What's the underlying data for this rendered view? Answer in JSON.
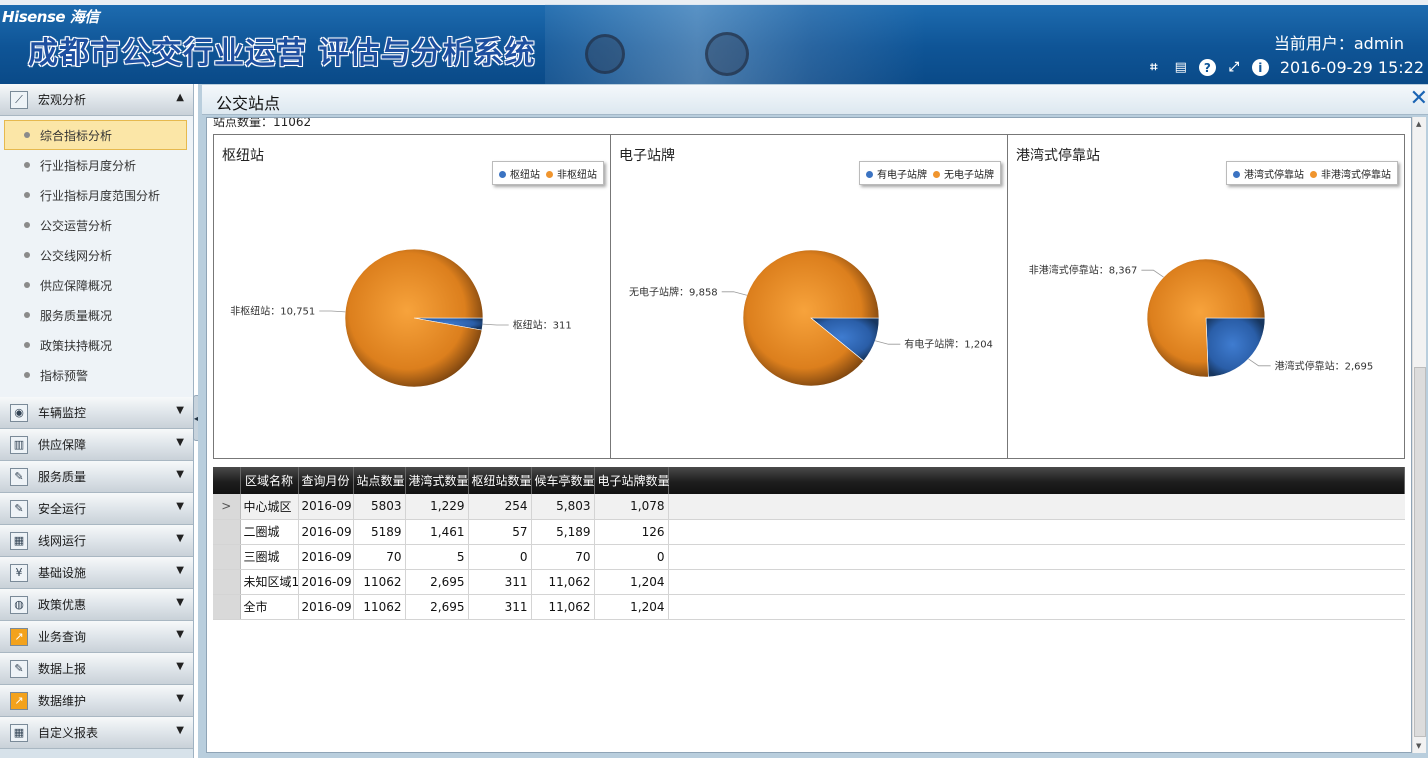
{
  "header": {
    "brand": "Hisense 海信",
    "title": "成都市公交行业运营 评估与分析系统",
    "user_line": "当前用户：admin",
    "datetime": "2016-09-29 15:22",
    "toolbar_icons": [
      "crop-icon",
      "keyboard-icon",
      "help-icon",
      "fullscreen-icon",
      "info-icon"
    ]
  },
  "sidebar": {
    "groups": [
      {
        "label": "宏观分析",
        "icon": "chart-icon",
        "expanded": true
      },
      {
        "label": "车辆监控",
        "icon": "camera-icon"
      },
      {
        "label": "供应保障",
        "icon": "supply-icon"
      },
      {
        "label": "服务质量",
        "icon": "edit-icon"
      },
      {
        "label": "安全运行",
        "icon": "edit-icon"
      },
      {
        "label": "线网运行",
        "icon": "calendar-icon"
      },
      {
        "label": "基础设施",
        "icon": "money-icon"
      },
      {
        "label": "政策优惠",
        "icon": "globe-icon"
      },
      {
        "label": "业务查询",
        "icon": "trend-icon"
      },
      {
        "label": "数据上报",
        "icon": "edit-icon"
      },
      {
        "label": "数据维护",
        "icon": "trend-icon"
      },
      {
        "label": "自定义报表",
        "icon": "calendar-icon"
      }
    ],
    "submenu": [
      {
        "label": "综合指标分析",
        "active": true
      },
      {
        "label": "行业指标月度分析"
      },
      {
        "label": "行业指标月度范围分析"
      },
      {
        "label": "公交运营分析"
      },
      {
        "label": "公交线网分析"
      },
      {
        "label": "供应保障概况"
      },
      {
        "label": "服务质量概况"
      },
      {
        "label": "政策扶持概况"
      },
      {
        "label": "指标预警"
      }
    ]
  },
  "panel": {
    "title": "公交站点",
    "station_count_label": "站点数量：11062"
  },
  "colors": {
    "blue": "#3b73c2",
    "orange": "#f0952e",
    "header_bg": "#0f5597"
  },
  "chart_data": [
    {
      "type": "pie",
      "title": "枢纽站",
      "legend": [
        "枢纽站",
        "非枢纽站"
      ],
      "slices": [
        {
          "name": "枢纽站",
          "value": 311,
          "label": "枢纽站：311",
          "color": "blue"
        },
        {
          "name": "非枢纽站",
          "value": 10751,
          "label": "非枢纽站：10,751",
          "color": "orange"
        }
      ]
    },
    {
      "type": "pie",
      "title": "电子站牌",
      "legend": [
        "有电子站牌",
        "无电子站牌"
      ],
      "slices": [
        {
          "name": "有电子站牌",
          "value": 1204,
          "label": "有电子站牌：1,204",
          "color": "blue"
        },
        {
          "name": "无电子站牌",
          "value": 9858,
          "label": "无电子站牌：9,858",
          "color": "orange"
        }
      ]
    },
    {
      "type": "pie",
      "title": "港湾式停靠站",
      "legend": [
        "港湾式停靠站",
        "非港湾式停靠站"
      ],
      "slices": [
        {
          "name": "港湾式停靠站",
          "value": 2695,
          "label": "港湾式停靠站：2,695",
          "color": "blue"
        },
        {
          "name": "非港湾式停靠站",
          "value": 8367,
          "label": "非港湾式停靠站：8,367",
          "color": "orange"
        }
      ]
    }
  ],
  "table": {
    "columns": [
      "区域名称",
      "查询月份",
      "站点数量",
      "港湾式数量",
      "枢纽站数量",
      "候车亭数量",
      "电子站牌数量"
    ],
    "rows": [
      [
        "中心城区",
        "2016-09",
        "5803",
        "1,229",
        "254",
        "5,803",
        "1,078"
      ],
      [
        "二圈城",
        "2016-09",
        "5189",
        "1,461",
        "57",
        "5,189",
        "126"
      ],
      [
        "三圈城",
        "2016-09",
        "70",
        "5",
        "0",
        "70",
        "0"
      ],
      [
        "未知区域1",
        "2016-09",
        "11062",
        "2,695",
        "311",
        "11,062",
        "1,204"
      ],
      [
        "全市",
        "2016-09",
        "11062",
        "2,695",
        "311",
        "11,062",
        "1,204"
      ]
    ],
    "current_row_marker": ">"
  }
}
